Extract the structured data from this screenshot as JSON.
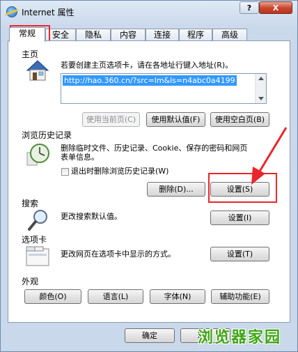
{
  "window": {
    "title": "Internet 属性",
    "help_label": "?",
    "close_label": "X"
  },
  "tabs": [
    {
      "label": "常规"
    },
    {
      "label": "安全"
    },
    {
      "label": "隐私"
    },
    {
      "label": "内容"
    },
    {
      "label": "连接"
    },
    {
      "label": "程序"
    },
    {
      "label": "高级"
    }
  ],
  "home": {
    "section_label": "主页",
    "hint": "若要创建主页选项卡，请在各地址行键入地址(R)。",
    "address": "http://hao.360.cn/?src=lm&ls=n4abc0a4199",
    "btn_current": "使用当前页(C)",
    "btn_default": "使用默认值(F)",
    "btn_blank": "使用空白页(B)"
  },
  "history": {
    "section_label": "浏览历史记录",
    "hint_line1": "删除临时文件、历史记录、Cookie、保存的密码和网页",
    "hint_line2": "表单信息。",
    "checkbox_label": "退出时删除浏览历史记录(W)",
    "btn_delete": "删除(D)...",
    "btn_settings": "设置(S)"
  },
  "search": {
    "section_label": "搜索",
    "hint": "更改搜索默认值。",
    "btn_settings": "设置(I)"
  },
  "tabs_section": {
    "section_label": "选项卡",
    "hint": "更改网页在选项卡中显示的方式。",
    "btn_settings": "设置(T)"
  },
  "appearance": {
    "section_label": "外观",
    "btn_colors": "颜色(O)",
    "btn_languages": "语言(L)",
    "btn_fonts": "字体(N)",
    "btn_accessibility": "辅助功能(E)"
  },
  "footer": {
    "btn_ok": "确定",
    "btn_cancel": "取消"
  },
  "watermark": "浏览器家园",
  "colors": {
    "highlight_red": "#e8262b",
    "selection_blue": "#3399ff",
    "watermark_green": "#3fa514"
  }
}
